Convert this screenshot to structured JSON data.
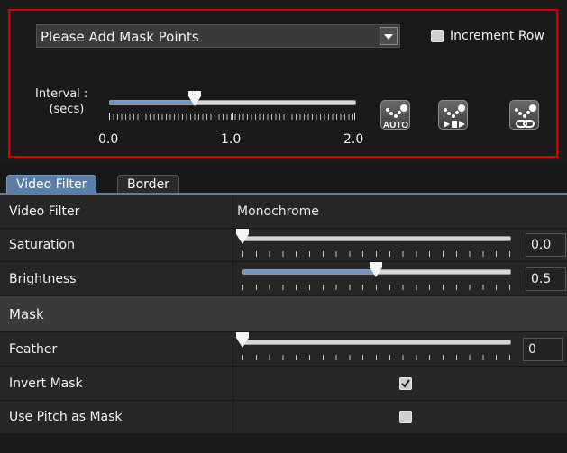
{
  "mask_panel": {
    "select_value": "Please Add Mask Points",
    "increment_row_label": "Increment Row",
    "increment_row_checked": false,
    "interval_label_line1": "Interval :",
    "interval_label_line2": "(secs)",
    "interval_value": 0.7,
    "interval_min": 0.0,
    "interval_max": 2.0,
    "interval_tick_labels": [
      "0.0",
      "1.0",
      "2.0"
    ],
    "buttons": [
      {
        "icon": "auto-track-icon",
        "caption": "AUTO"
      },
      {
        "icon": "step-track-icon"
      },
      {
        "icon": "link-track-icon"
      }
    ]
  },
  "tabs": [
    "Video Filter",
    "Border"
  ],
  "active_tab": "Video Filter",
  "properties": {
    "video_filter_label": "Video Filter",
    "video_filter_value": "Monochrome",
    "saturation_label": "Saturation",
    "saturation_value": "0.0",
    "saturation_fraction": 0.0,
    "brightness_label": "Brightness",
    "brightness_value": "0.5",
    "brightness_fraction": 0.5,
    "mask_section_label": "Mask",
    "feather_label": "Feather",
    "feather_value": "0",
    "feather_fraction": 0.0,
    "invert_mask_label": "Invert Mask",
    "invert_mask_checked": true,
    "use_pitch_label": "Use Pitch as Mask",
    "use_pitch_checked": false
  },
  "colors": {
    "highlight_border": "#d40000",
    "accent": "#5b7ea8",
    "slider_fill": "#6f96c6"
  }
}
